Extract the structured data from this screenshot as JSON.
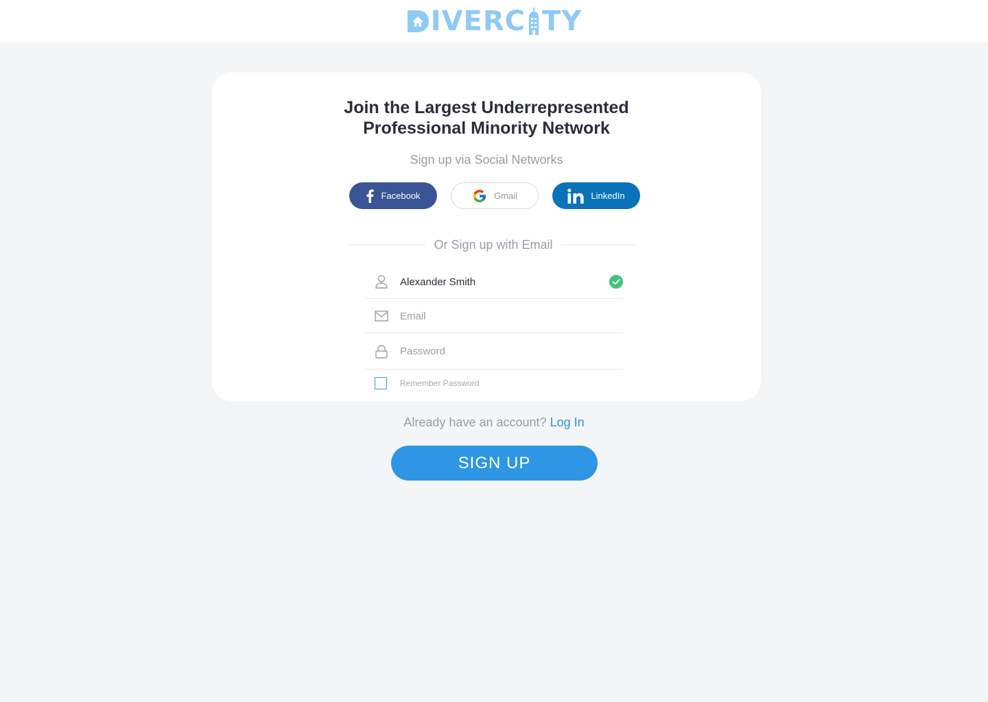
{
  "brand": {
    "name": "DIVERCITY",
    "logo_parts": {
      "before_tower": "IVERC",
      "after_tower": "TY"
    },
    "color": "#8fcaf5"
  },
  "card": {
    "headline_line1": "Join the Largest Underrepresented",
    "headline_line2": "Professional Minority Network",
    "social_heading": "Sign up via Social Networks",
    "social_buttons": [
      {
        "label": "Facebook",
        "icon": "facebook-icon",
        "color": "#3b5496"
      },
      {
        "label": "Gmail",
        "icon": "google-icon",
        "color": "#ffffff"
      },
      {
        "label": "LinkedIn",
        "icon": "linkedin-icon",
        "color": "#0a72b8"
      }
    ],
    "divider_text": "Or Sign up with Email",
    "fields": {
      "name": {
        "value": "Alexander Smith",
        "icon": "user-icon",
        "valid": true
      },
      "email": {
        "placeholder": "Email",
        "icon": "mail-icon"
      },
      "password": {
        "placeholder": "Password",
        "icon": "lock-icon"
      }
    },
    "remember_label": "Remember Password"
  },
  "footer": {
    "already_text": "Already have an account?",
    "login_label": "Log In",
    "signup_label": "SIGN UP"
  },
  "colors": {
    "accent": "#2e96e5",
    "link": "#2e8fe0",
    "success": "#3ec47a",
    "background": "#f4f5f7"
  }
}
